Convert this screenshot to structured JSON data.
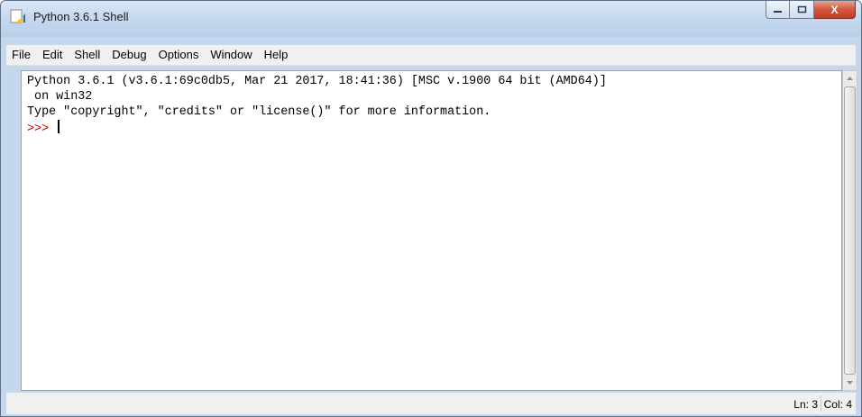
{
  "window": {
    "title": "Python 3.6.1 Shell",
    "close_symbol": "X"
  },
  "menubar": {
    "items": [
      "File",
      "Edit",
      "Shell",
      "Debug",
      "Options",
      "Window",
      "Help"
    ]
  },
  "shell": {
    "lines": [
      "Python 3.6.1 (v3.6.1:69c0db5, Mar 21 2017, 18:41:36) [MSC v.1900 64 bit (AMD64)]",
      " on win32",
      "Type \"copyright\", \"credits\" or \"license()\" for more information."
    ],
    "prompt": ">>> "
  },
  "statusbar": {
    "line": "Ln: 3",
    "col": "Col: 4"
  },
  "colors": {
    "prompt": "#c00000",
    "titlebar": "#c6d9f0",
    "close_button": "#c43c22"
  }
}
